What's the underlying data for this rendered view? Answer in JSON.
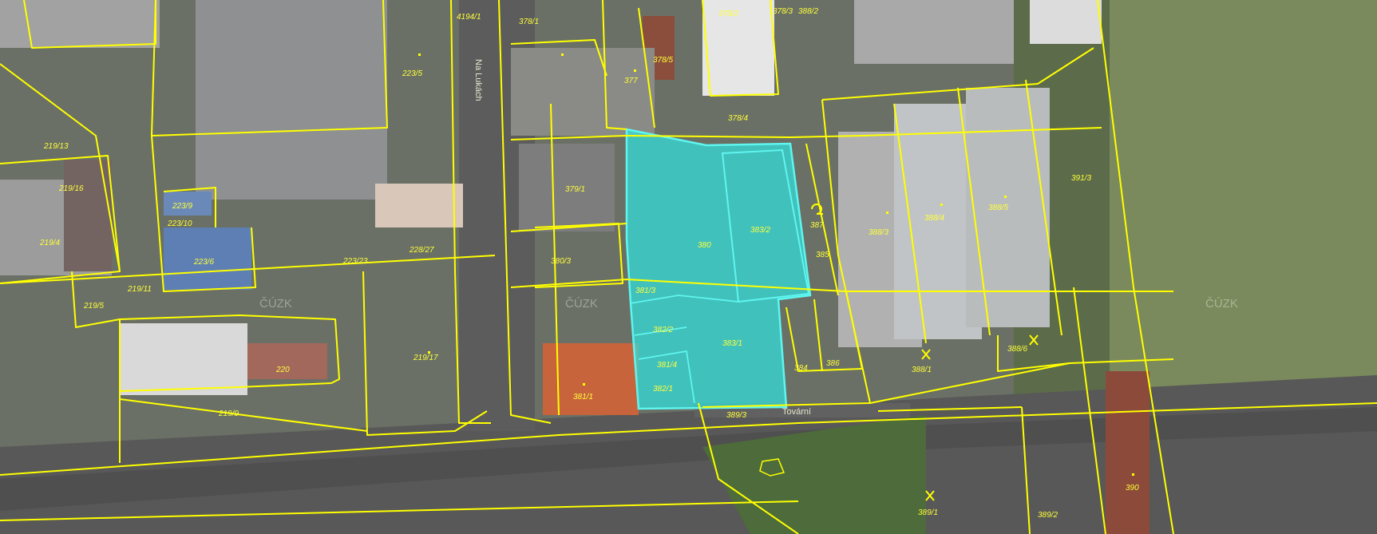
{
  "watermark": "ČÚZK",
  "streets": {
    "na_lukach": "Na Lukách",
    "tovarni": "Tovární"
  },
  "parcels": [
    "4194/1",
    "378/1",
    "378/2",
    "378/3",
    "378/5",
    "377",
    "378/4",
    "388/2",
    "223/5",
    "219/13",
    "219/16",
    "223/9",
    "223/10",
    "219/4",
    "223/6",
    "223/23",
    "228/27",
    "219/11",
    "219/5",
    "220",
    "219/17",
    "219/9",
    "379/1",
    "380/3",
    "381/3",
    "382/2",
    "381/4",
    "382/1",
    "381/1",
    "380",
    "383/2",
    "383/1",
    "387",
    "385",
    "384",
    "386",
    "388/3",
    "388/4",
    "388/5",
    "388/1",
    "388/6",
    "391/3",
    "389/3",
    "389/1",
    "389/2",
    "390"
  ],
  "colors": {
    "boundary": "#ffff00",
    "selection_fill": "#2ee8e6",
    "selection_stroke": "#5ff5f0"
  },
  "legend_icons": [
    "point-marker-icon",
    "mine-symbol-icon"
  ]
}
